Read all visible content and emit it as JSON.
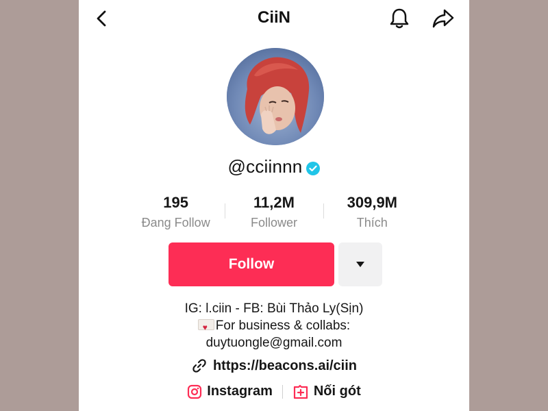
{
  "header": {
    "title": "CiiN",
    "back_icon": "chevron-left-icon",
    "bell_icon": "bell-icon",
    "share_icon": "share-icon"
  },
  "profile": {
    "username": "@cciinnn",
    "verified": true
  },
  "stats": [
    {
      "value": "195",
      "label": "Đang Follow"
    },
    {
      "value": "11,2M",
      "label": "Follower"
    },
    {
      "value": "309,9M",
      "label": "Thích"
    }
  ],
  "actions": {
    "follow_label": "Follow",
    "dropdown_icon": "caret-down-icon"
  },
  "bio": {
    "line1": "IG: l.ciin - FB: Bùi Thảo Ly(Sịn)",
    "line2": "For business & collabs:",
    "line3": "duytuongle@gmail.com"
  },
  "link": {
    "url": "https://beacons.ai/ciin",
    "icon": "link-icon"
  },
  "socials": [
    {
      "label": "Instagram",
      "icon": "instagram-icon"
    },
    {
      "label": "Nối gót",
      "icon": "add-duet-icon"
    }
  ],
  "colors": {
    "background": "#ad9c98",
    "follow_button": "#fd2d55",
    "verified_badge": "#20c5e8",
    "accent_icon": "#fd2d55"
  }
}
